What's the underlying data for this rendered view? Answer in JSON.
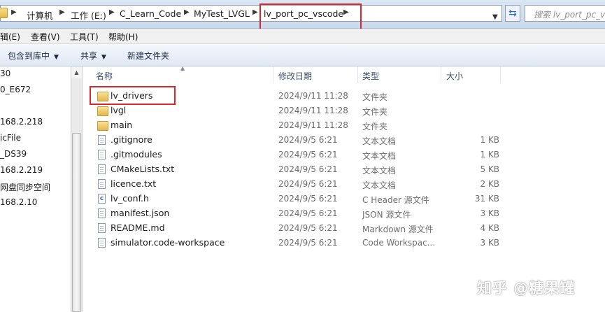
{
  "address_bar": {
    "crumbs": [
      "计算机",
      "工作 (E:)",
      "C_Learn_Code",
      "MyTest_LVGL",
      "lv_port_pc_vscode"
    ],
    "search_placeholder": "搜索 lv_port_pc_vscode"
  },
  "menu": [
    "编辑(E)",
    "查看(V)",
    "工具(T)",
    "帮助(H)"
  ],
  "command_bar": {
    "include_library": "包含到库中",
    "share": "共享",
    "new_folder": "新建文件夹"
  },
  "nav_pane": {
    "items": [
      "30",
      "0_E672",
      "168.2.218",
      "icFile",
      "_DS39",
      "168.2.219",
      "网盘同步空间",
      "168.2.10"
    ]
  },
  "columns": {
    "name": "名称",
    "date": "修改日期",
    "type": "类型",
    "size": "大小"
  },
  "files": [
    {
      "name": "lv_drivers",
      "date": "2024/9/11 11:28",
      "type": "文件夹",
      "size": "",
      "icon": "folder-icon"
    },
    {
      "name": "lvgl",
      "date": "2024/9/11 11:28",
      "type": "文件夹",
      "size": "",
      "icon": "folder-icon"
    },
    {
      "name": "main",
      "date": "2024/9/11 11:28",
      "type": "文件夹",
      "size": "",
      "icon": "folder-icon"
    },
    {
      "name": ".gitignore",
      "date": "2024/9/5 6:21",
      "type": "文本文档",
      "size": "1 KB",
      "icon": "text-file-icon"
    },
    {
      "name": ".gitmodules",
      "date": "2024/9/5 6:21",
      "type": "文本文档",
      "size": "1 KB",
      "icon": "text-file-icon"
    },
    {
      "name": "CMakeLists.txt",
      "date": "2024/9/5 6:21",
      "type": "文本文档",
      "size": "5 KB",
      "icon": "text-file-icon"
    },
    {
      "name": "licence.txt",
      "date": "2024/9/5 6:21",
      "type": "文本文档",
      "size": "2 KB",
      "icon": "text-file-icon"
    },
    {
      "name": "lv_conf.h",
      "date": "2024/9/5 6:21",
      "type": "C Header 源文件",
      "size": "31 KB",
      "icon": "c-header-file-icon"
    },
    {
      "name": "manifest.json",
      "date": "2024/9/5 6:21",
      "type": "JSON 源文件",
      "size": "3 KB",
      "icon": "text-file-icon"
    },
    {
      "name": "README.md",
      "date": "2024/9/5 6:21",
      "type": "Markdown 源文件",
      "size": "4 KB",
      "icon": "text-file-icon"
    },
    {
      "name": "simulator.code-workspace",
      "date": "2024/9/5 6:21",
      "type": "Code Workspac...",
      "size": "3 KB",
      "icon": "text-file-icon"
    }
  ],
  "watermark": "知乎 @糖果罐"
}
